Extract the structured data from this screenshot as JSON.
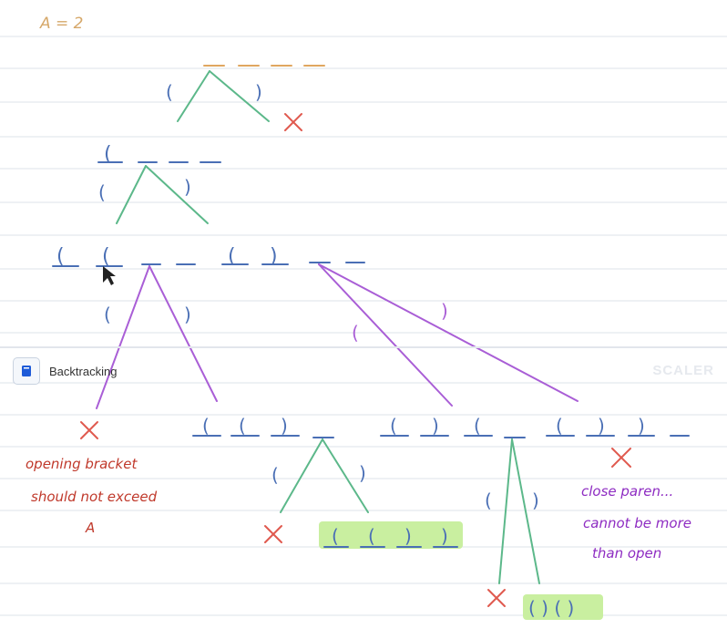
{
  "title": "A = 2",
  "badge": {
    "label": "Backtracking",
    "icon": "book-icon"
  },
  "brand": "SCALER",
  "notes": {
    "opening": [
      "opening bracket",
      "should not exceed",
      "A"
    ],
    "closing": [
      "close paren...",
      "cannot be more",
      "than open"
    ]
  },
  "results": {
    "valid_1": "( ( ) )",
    "valid_2": "( ) ( )"
  },
  "colors": {
    "tree_green": "#5cb88a",
    "tree_purple": "#a95ed6",
    "bracket_blue": "#4a6fb5",
    "reject_red": "#e05a4f",
    "highlight": "#c9efa0",
    "slot_orange": "#e0a760",
    "rule_line": "#dde3ea"
  }
}
